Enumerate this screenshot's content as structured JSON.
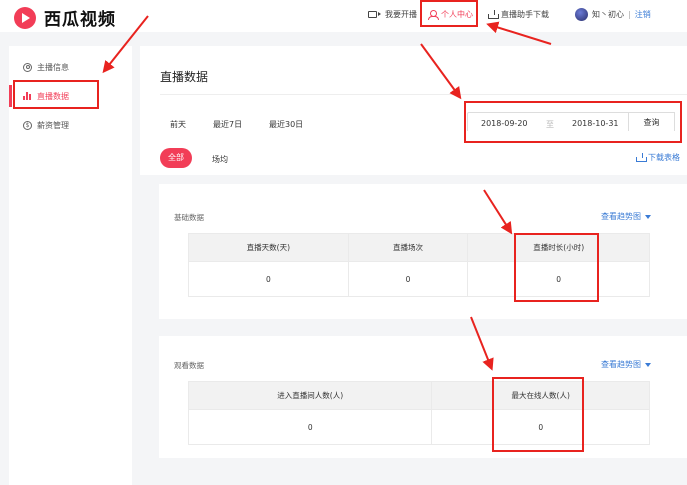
{
  "app": {
    "logo_text": "西瓜视频"
  },
  "header": {
    "nav": [
      {
        "label": "我要开播",
        "icon": "video-camera-icon"
      },
      {
        "label": "个人中心",
        "icon": "user-icon"
      },
      {
        "label": "直播助手下载",
        "icon": "download-icon"
      }
    ],
    "user_name": "知丶初心",
    "separator": "|",
    "logout_label": "注销"
  },
  "sidebar": {
    "items": [
      {
        "label": "主播信息",
        "icon": "user-circle-icon",
        "active": false
      },
      {
        "label": "直播数据",
        "icon": "bar-chart-icon",
        "active": true
      },
      {
        "label": "薪资管理",
        "icon": "dollar-icon",
        "active": false
      }
    ]
  },
  "main": {
    "title": "直播数据",
    "range_tabs": [
      "前天",
      "最近7日",
      "最近30日"
    ],
    "date_from": "2018-09-20",
    "date_sep": "至",
    "date_to": "2018-10-31",
    "query_label": "查询",
    "filters": [
      "全部",
      "场均"
    ],
    "download_label": "下载表格",
    "basic": {
      "label": "基础数据",
      "trend_label": "查看趋势图",
      "headers": [
        "直播天数(天)",
        "直播场次",
        "直播时长(小时)"
      ],
      "values": [
        "0",
        "0",
        "0"
      ]
    },
    "watch": {
      "label": "观看数据",
      "trend_label": "查看趋势图",
      "headers": [
        "进入直播间人数(人)",
        "最大在线人数(人)"
      ],
      "values": [
        "0",
        "0"
      ]
    }
  },
  "colors": {
    "brand": "#f23d57",
    "link": "#3a7bd5",
    "annotation": "#e8231f"
  }
}
